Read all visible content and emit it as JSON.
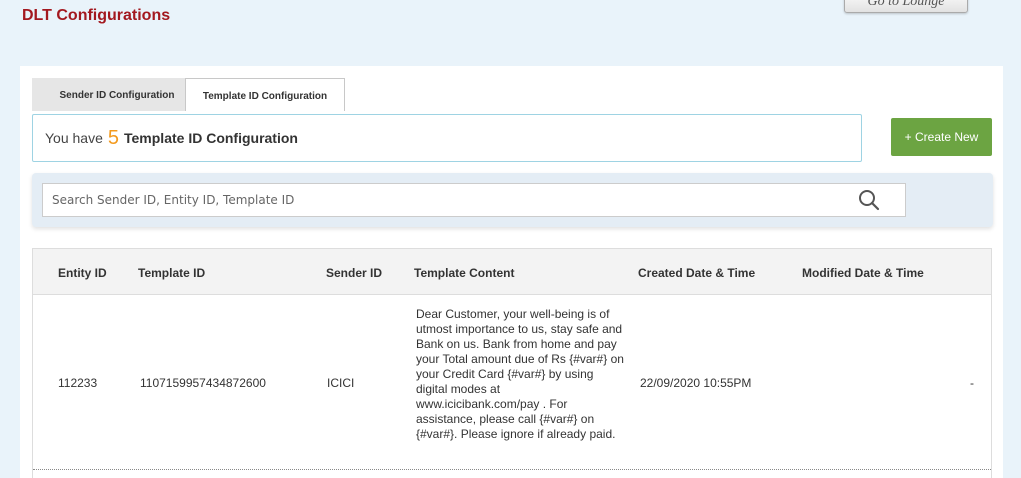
{
  "page": {
    "title": "DLT Configurations",
    "lounge_button": "Go to Lounge"
  },
  "tabs": [
    {
      "label": "Sender ID Configuration",
      "active": false
    },
    {
      "label": "Template ID Configuration",
      "active": true
    }
  ],
  "summary": {
    "prefix": "You have",
    "count": "5",
    "suffix": "Template ID Configuration"
  },
  "create_button": "+ Create New",
  "search": {
    "placeholder": "Search Sender ID, Entity ID, Template ID",
    "icon": "magnifier"
  },
  "table": {
    "columns": [
      "Entity ID",
      "Template ID",
      "Sender ID",
      "Template Content",
      "Created Date & Time",
      "Modified Date & Time"
    ],
    "rows": [
      {
        "entity_id": "112233",
        "template_id": "1107159957434872600",
        "sender_id": "ICICI",
        "content": "Dear Customer, your well-being is of utmost importance to us, stay safe and Bank on us. Bank from home and pay your Total amount due of Rs {#var#} on your Credit Card {#var#} by using digital modes at www.icicibank.com/pay . For assistance, please call {#var#} on {#var#}. Please ignore if already paid.",
        "created": "22/09/2020 10:55PM",
        "modified": "-"
      }
    ]
  },
  "colors": {
    "title": "#a3181f",
    "count": "#f39a1e",
    "create_button": "#6ca442",
    "background": "#e9f3fa"
  }
}
